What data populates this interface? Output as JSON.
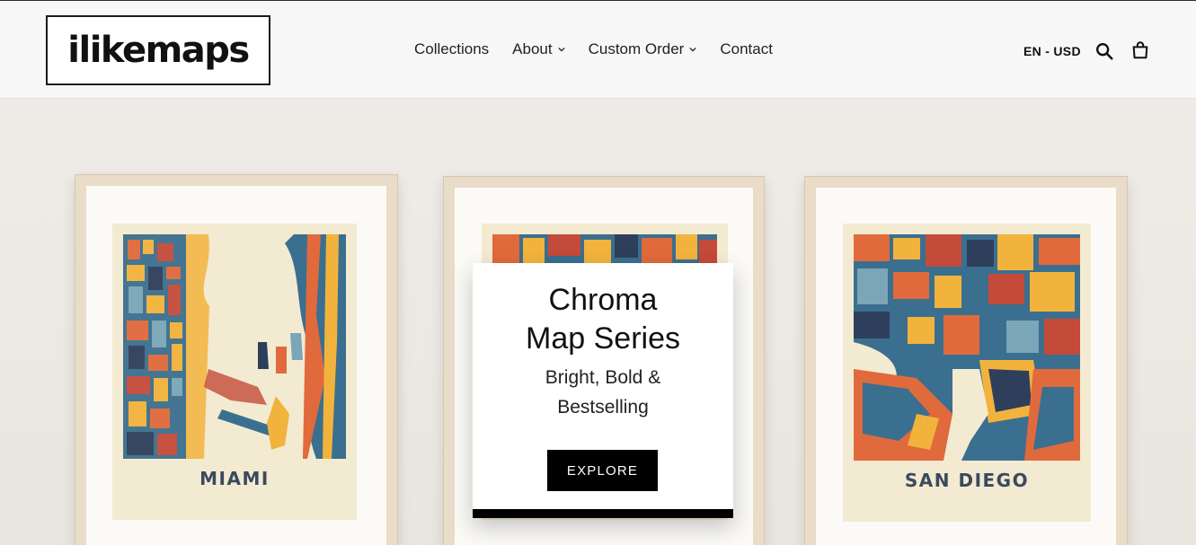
{
  "header": {
    "logo_text": "ilikemaps",
    "nav": [
      {
        "label": "Collections",
        "has_dropdown": false
      },
      {
        "label": "About",
        "has_dropdown": true
      },
      {
        "label": "Custom Order",
        "has_dropdown": true
      },
      {
        "label": "Contact",
        "has_dropdown": false
      }
    ],
    "locale_label": "EN - USD",
    "search_icon": "search-icon",
    "cart_icon": "cart-icon"
  },
  "hero": {
    "prints": [
      {
        "city": "MIAMI"
      },
      {
        "city": ""
      },
      {
        "city": "SAN DIEGO"
      }
    ],
    "promo": {
      "title_line1": "Chroma",
      "title_line2": "Map Series",
      "subtitle_line1": "Bright, Bold &",
      "subtitle_line2": "Bestselling",
      "cta_label": "EXPLORE"
    }
  },
  "colors": {
    "map_palette": [
      "#3b6f8f",
      "#e06a3c",
      "#f2b33d",
      "#2e3f5c",
      "#c44a3a",
      "#7aa6b8"
    ],
    "print_paper": "#f3ead2",
    "frame": "#e9dcc8",
    "cta_background": "#000000"
  }
}
